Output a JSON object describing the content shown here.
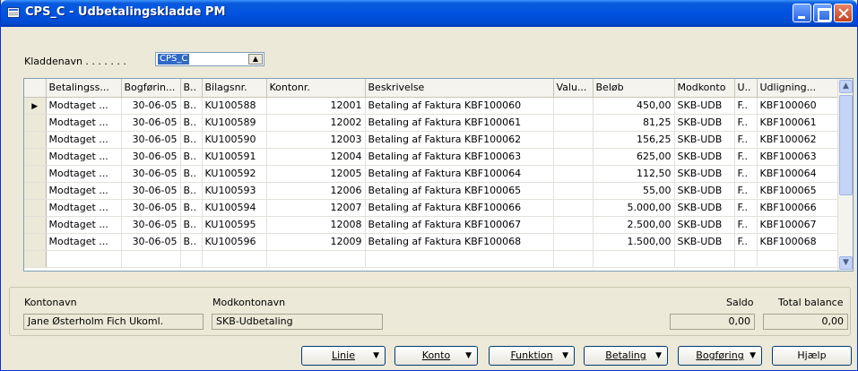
{
  "window": {
    "title": "CPS_C - Udbetalingskladde PM",
    "icon": "form-icon"
  },
  "batch": {
    "label": "Kladdenavn . . . . . . .",
    "value": "CPS_C",
    "dropdown_icon": "lookup-arrow-icon"
  },
  "table": {
    "columns": [
      "Betalingss...",
      "Bogførin...",
      "B..",
      "Bilagsnr.",
      "Kontonr.",
      "Beskrivelse",
      "Valu...",
      "Beløb",
      "Modkonto",
      "U..",
      "Udligning..."
    ],
    "rows": [
      [
        "Modtaget ...",
        "30-06-05",
        "B..",
        "KU100588",
        "12001",
        "Betaling af Faktura KBF100060",
        "",
        "450,00",
        "SKB-UDB",
        "F..",
        "KBF100060"
      ],
      [
        "Modtaget ...",
        "30-06-05",
        "B..",
        "KU100589",
        "12002",
        "Betaling af Faktura KBF100061",
        "",
        "81,25",
        "SKB-UDB",
        "F..",
        "KBF100061"
      ],
      [
        "Modtaget ...",
        "30-06-05",
        "B..",
        "KU100590",
        "12003",
        "Betaling af Faktura KBF100062",
        "",
        "156,25",
        "SKB-UDB",
        "F..",
        "KBF100062"
      ],
      [
        "Modtaget ...",
        "30-06-05",
        "B..",
        "KU100591",
        "12004",
        "Betaling af Faktura KBF100063",
        "",
        "625,00",
        "SKB-UDB",
        "F..",
        "KBF100063"
      ],
      [
        "Modtaget ...",
        "30-06-05",
        "B..",
        "KU100592",
        "12005",
        "Betaling af Faktura KBF100064",
        "",
        "112,50",
        "SKB-UDB",
        "F..",
        "KBF100064"
      ],
      [
        "Modtaget ...",
        "30-06-05",
        "B..",
        "KU100593",
        "12006",
        "Betaling af Faktura KBF100065",
        "",
        "55,00",
        "SKB-UDB",
        "F..",
        "KBF100065"
      ],
      [
        "Modtaget ...",
        "30-06-05",
        "B..",
        "KU100594",
        "12007",
        "Betaling af Faktura KBF100066",
        "",
        "5.000,00",
        "SKB-UDB",
        "F..",
        "KBF100066"
      ],
      [
        "Modtaget ...",
        "30-06-05",
        "B..",
        "KU100595",
        "12008",
        "Betaling af Faktura KBF100067",
        "",
        "2.500,00",
        "SKB-UDB",
        "F..",
        "KBF100067"
      ],
      [
        "Modtaget ...",
        "30-06-05",
        "B..",
        "KU100596",
        "12009",
        "Betaling af Faktura KBF100068",
        "",
        "1.500,00",
        "SKB-UDB",
        "F..",
        "KBF100068"
      ]
    ]
  },
  "footer": {
    "account_name_label": "Kontonavn",
    "account_name_value": "Jane Østerholm Fich Ukoml.",
    "balancing_name_label": "Modkontonavn",
    "balancing_name_value": "SKB-Udbetaling",
    "balance_label": "Saldo",
    "balance_value": "0,00",
    "total_balance_label": "Total balance",
    "total_balance_value": "0,00"
  },
  "buttons": {
    "line": "Linie",
    "account": "Konto",
    "function": "Funktion",
    "payment": "Betaling",
    "posting": "Bogføring",
    "help": "Hjælp"
  }
}
